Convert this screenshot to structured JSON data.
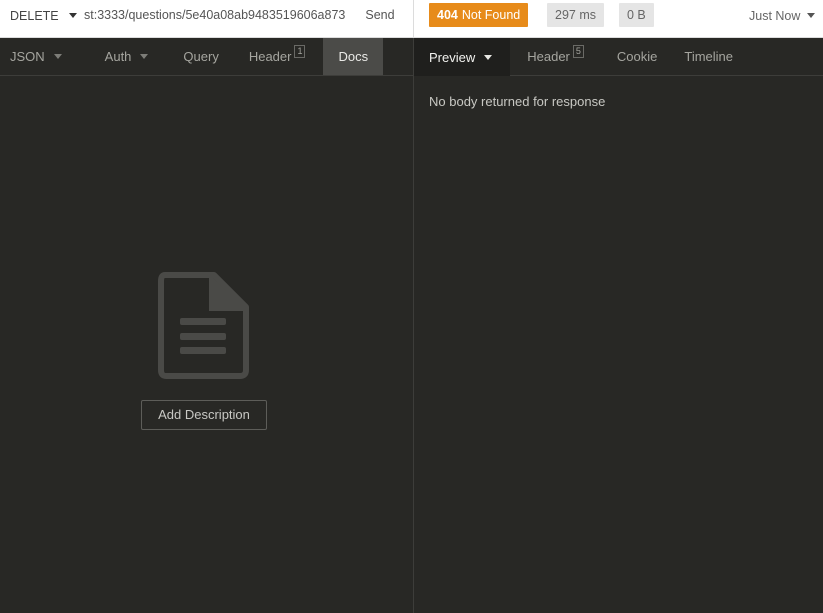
{
  "request": {
    "method": "DELETE",
    "url": "st:3333/questions/5e40a08ab9483519606a873",
    "send_label": "Send"
  },
  "response_meta": {
    "status_code": "404",
    "status_text": "Not Found",
    "time": "297 ms",
    "size": "0 B",
    "history_label": "Just Now",
    "status_color": "#e78b1a"
  },
  "request_tabs": [
    {
      "label": "JSON",
      "has_caret": true
    },
    {
      "label": "Auth",
      "has_caret": true
    },
    {
      "label": "Query"
    },
    {
      "label": "Header",
      "count": "1"
    },
    {
      "label": "Docs",
      "active": true
    }
  ],
  "response_tabs": [
    {
      "label": "Preview",
      "has_caret": true,
      "active": true
    },
    {
      "label": "Header",
      "count": "5"
    },
    {
      "label": "Cookie"
    },
    {
      "label": "Timeline"
    }
  ],
  "docs": {
    "icon": "document-icon",
    "add_description_label": "Add Description"
  },
  "preview": {
    "message": "No body returned for response"
  }
}
